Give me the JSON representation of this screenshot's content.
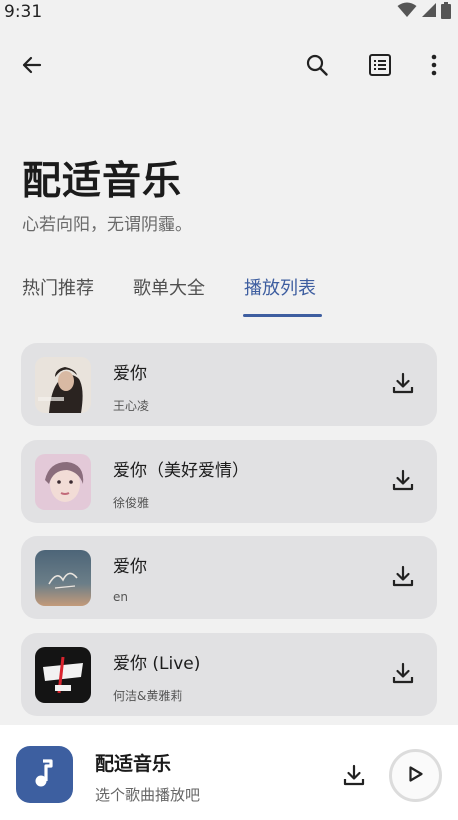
{
  "status_bar": {
    "time": "9:31"
  },
  "header": {
    "title": "配适音乐",
    "subtitle": "心若向阳，无谓阴霾。"
  },
  "tabs": [
    {
      "label": "热门推荐",
      "active": false
    },
    {
      "label": "歌单大全",
      "active": false
    },
    {
      "label": "播放列表",
      "active": true
    }
  ],
  "songs": [
    {
      "title": "爱你",
      "artist": "王心凌"
    },
    {
      "title": "爱你（美好爱情）",
      "artist": "徐俊雅"
    },
    {
      "title": "爱你",
      "artist": "en"
    },
    {
      "title": "爱你 (Live)",
      "artist": "何洁&黄雅莉"
    }
  ],
  "player": {
    "title": "配适音乐",
    "subtitle": "选个歌曲播放吧"
  },
  "colors": {
    "accent": "#3e5ea0",
    "background": "#f1f1f1",
    "card": "#e1e1e3"
  }
}
